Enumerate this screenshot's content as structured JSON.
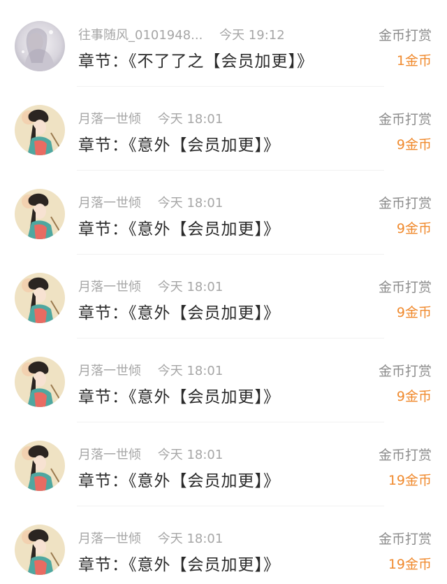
{
  "icons": {
    "avatar_user1": "avatar-misty-figure",
    "avatar_user2": "avatar-ancient-lady-illustration"
  },
  "colors": {
    "meta_text": "#a6a6a6",
    "chapter_text": "#2a2a2a",
    "reward_type": "#8c8c8c",
    "reward_amount": "#f08a2e"
  },
  "records": [
    {
      "user": "往事随风_0101948...",
      "time": "今天 19:12",
      "chapter": "章节：《不了了之【会员加更】》",
      "type": "金币打赏",
      "amount": "1金币"
    },
    {
      "user": "月落一世倾",
      "time": "今天 18:01",
      "chapter": "章节：《意外【会员加更】》",
      "type": "金币打赏",
      "amount": "9金币"
    },
    {
      "user": "月落一世倾",
      "time": "今天 18:01",
      "chapter": "章节：《意外【会员加更】》",
      "type": "金币打赏",
      "amount": "9金币"
    },
    {
      "user": "月落一世倾",
      "time": "今天 18:01",
      "chapter": "章节：《意外【会员加更】》",
      "type": "金币打赏",
      "amount": "9金币"
    },
    {
      "user": "月落一世倾",
      "time": "今天 18:01",
      "chapter": "章节：《意外【会员加更】》",
      "type": "金币打赏",
      "amount": "9金币"
    },
    {
      "user": "月落一世倾",
      "time": "今天 18:01",
      "chapter": "章节：《意外【会员加更】》",
      "type": "金币打赏",
      "amount": "19金币"
    },
    {
      "user": "月落一世倾",
      "time": "今天 18:01",
      "chapter": "章节：《意外【会员加更】》",
      "type": "金币打赏",
      "amount": "19金币"
    }
  ]
}
